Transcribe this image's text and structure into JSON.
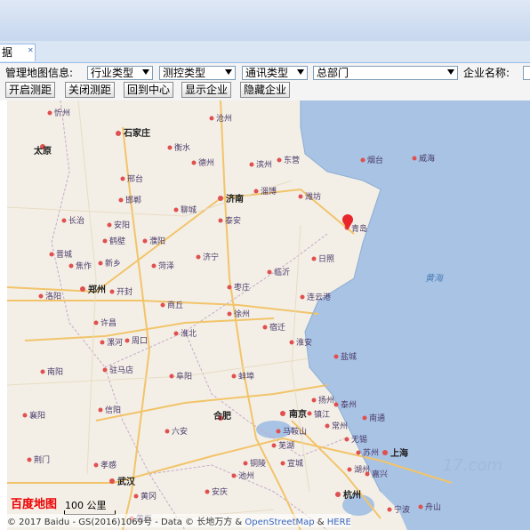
{
  "tab": {
    "label": "据"
  },
  "toolbar": {
    "info_label": "管理地图信息:",
    "industry_select": "行业类型",
    "monitor_select": "测控类型",
    "comm_select": "通讯类型",
    "dept_select": "总部门",
    "company_label": "企业名称:",
    "company_input": "",
    "buttons": [
      "开启测距",
      "关闭测距",
      "回到中心",
      "显示企业",
      "隐藏企业"
    ]
  },
  "map": {
    "sea_labels": [
      "黄海"
    ],
    "cities": [
      "忻州",
      "石家庄",
      "太原",
      "沧州",
      "衡水",
      "德州",
      "东营",
      "烟台",
      "威海",
      "滨州",
      "邢台",
      "济南",
      "淄博",
      "潍坊",
      "长治",
      "邯郸",
      "聊城",
      "泰安",
      "青岛",
      "安阳",
      "鹤壁",
      "濮阳",
      "晋城",
      "焦作",
      "新乡",
      "济宁",
      "菏泽",
      "临沂",
      "日照",
      "洛阳",
      "郑州",
      "开封",
      "商丘",
      "枣庄",
      "连云港",
      "许昌",
      "徐州",
      "宿迁",
      "漯河",
      "周口",
      "淮北",
      "南阳",
      "驻马店",
      "阜阳",
      "蚌埠",
      "盐城",
      "淮安",
      "信阳",
      "合肥",
      "南京",
      "扬州",
      "泰州",
      "南通",
      "襄阳",
      "六安",
      "镇江",
      "常州",
      "无锡",
      "上海",
      "苏州",
      "孝感",
      "荆门",
      "武汉",
      "黄冈",
      "安庆",
      "芜湖",
      "马鞍山",
      "铜陵",
      "宣城",
      "池州",
      "湖州",
      "嘉兴",
      "杭州",
      "宁波",
      "舟山",
      "黄石"
    ],
    "logo": "百度地图",
    "scale_label": "100 公里",
    "copyright_prefix": "© 2017 Baidu - GS(2016)1069号 - Data © 长地万方 & ",
    "osm_link": "OpenStreetMap",
    "amp": " & ",
    "here_link": "HERE"
  }
}
